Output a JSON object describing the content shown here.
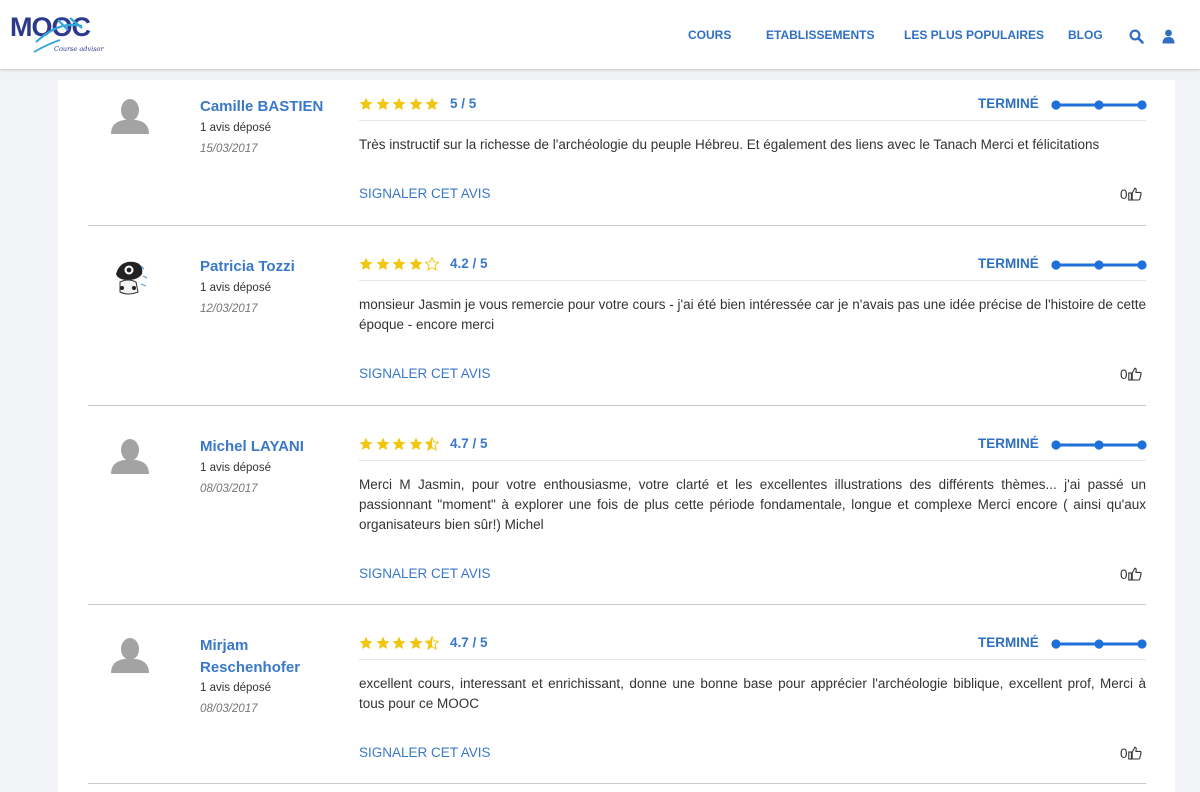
{
  "header": {
    "logo_text": "MOOC",
    "logo_subtitle": "Course advisor",
    "nav": [
      "COURS",
      "ETABLISSEMENTS",
      "LES PLUS POPULAIRES",
      "BLOG"
    ],
    "icons": [
      "search-icon",
      "user-icon"
    ]
  },
  "colors": {
    "link": "#3a78c9",
    "status": "#2d6fc2",
    "star": "#f2c511",
    "progress": "#1e6fd9"
  },
  "reviews": [
    {
      "name": "Camille BASTIEN",
      "count": "1 avis déposé",
      "date": "15/03/2017",
      "rating_display": "5 / 5",
      "rating": 5,
      "status": "TERMINÉ",
      "progress": 1,
      "text": "Très instructif sur la richesse de l'archéologie du peuple Hébreu. Et également des liens avec le Tanach Merci et félicitations",
      "report": "SIGNALER CET AVIS",
      "likes": "0",
      "avatar": "default-avatar"
    },
    {
      "name": "Patricia Tozzi",
      "count": "1 avis déposé",
      "date": "12/03/2017",
      "rating_display": "4.2 / 5",
      "rating": 4.2,
      "status": "TERMINÉ",
      "progress": 1,
      "text": "monsieur Jasmin je vous remercie pour votre cours - j'ai été bien intéressée car je n'avais pas une idée précise de l'histoire de cette époque - encore merci",
      "report": "SIGNALER CET AVIS",
      "likes": "0",
      "avatar": "custom-avatar"
    },
    {
      "name": "Michel LAYANI",
      "count": "1 avis déposé",
      "date": "08/03/2017",
      "rating_display": "4.7 / 5",
      "rating": 4.7,
      "status": "TERMINÉ",
      "progress": 1,
      "text": "Merci M Jasmin, pour votre enthousiasme, votre clarté et les excellentes illustrations des différents thèmes... j'ai passé un passionnant \"moment\" à explorer une fois de plus cette période fondamentale, longue et complexe Merci encore ( ainsi qu'aux organisateurs bien sûr!) Michel",
      "report": "SIGNALER CET AVIS",
      "likes": "0",
      "avatar": "default-avatar"
    },
    {
      "name": "Mirjam Reschenhofer",
      "count": "1 avis déposé",
      "date": "08/03/2017",
      "rating_display": "4.7 / 5",
      "rating": 4.7,
      "status": "TERMINÉ",
      "progress": 1,
      "text": "excellent cours, interessant et enrichissant, donne une bonne base pour apprécier l'archéologie biblique, excellent prof, Merci à tous pour ce MOOC",
      "report": "SIGNALER CET AVIS",
      "likes": "0",
      "avatar": "default-avatar"
    }
  ]
}
